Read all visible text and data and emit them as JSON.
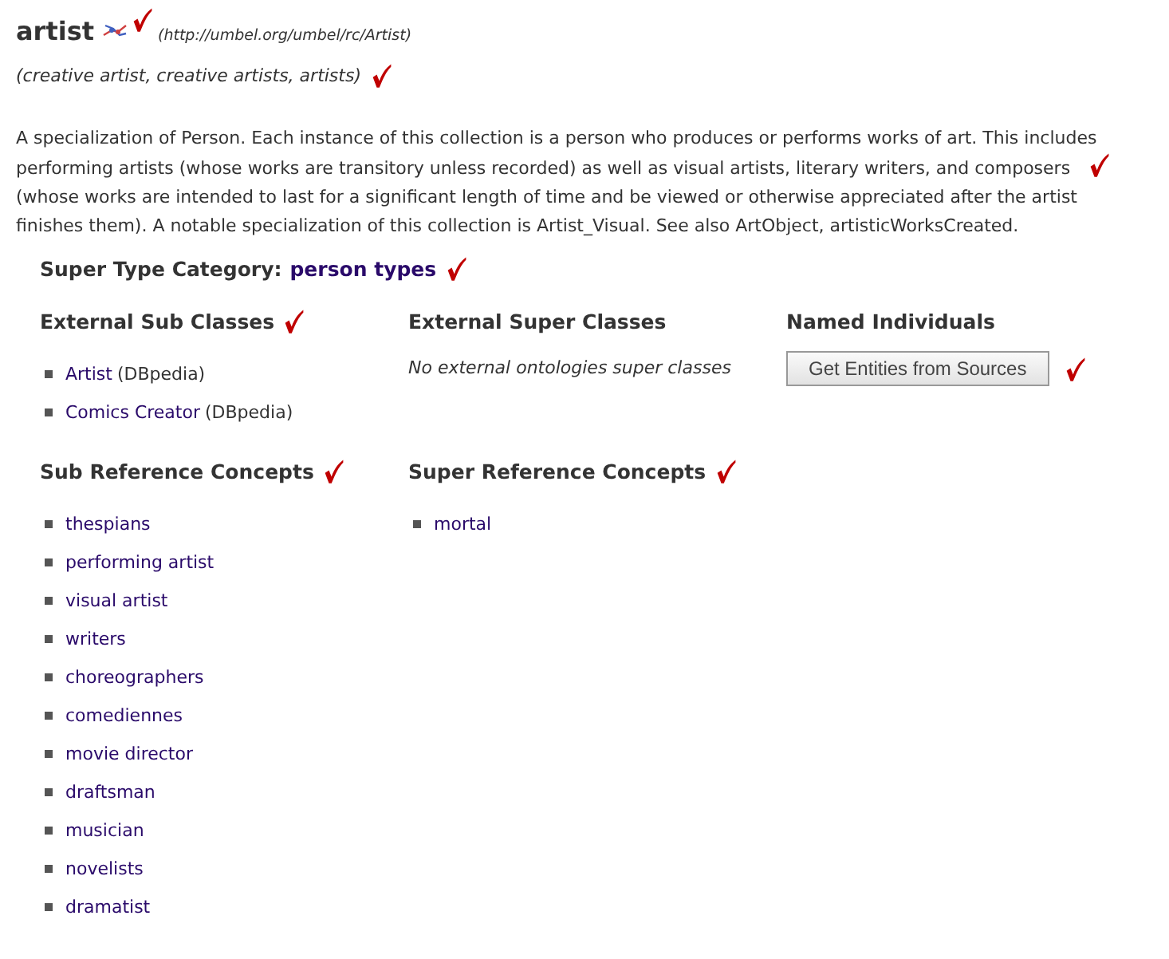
{
  "header": {
    "title": "artist",
    "uri": "(http://umbel.org/umbel/rc/Artist)",
    "marked": true
  },
  "alt_labels": {
    "text": "(creative artist, creative artists, artists)",
    "marked": true
  },
  "description": {
    "text": "A specialization of Person. Each instance of this collection is a person who produces or performs works of art. This includes performing artists (whose works are transitory unless recorded) as well as visual artists, literary writers, and composers",
    "text_continued": "(whose works are intended to last for a significant length of time and be viewed or otherwise appreciated after the artist finishes them). A notable specialization of this collection is Artist_Visual. See also ArtObject, artisticWorksCreated.",
    "marked": true
  },
  "super_type": {
    "label": "Super Type Category:",
    "value": "person types",
    "marked": true
  },
  "external_sub_classes": {
    "heading": "External Sub Classes",
    "marked": true,
    "items": [
      {
        "label": "Artist",
        "source": "(DBpedia)"
      },
      {
        "label": "Comics Creator",
        "source": "(DBpedia)"
      }
    ]
  },
  "external_super_classes": {
    "heading": "External Super Classes",
    "marked": false,
    "empty_text": "No external ontologies super classes"
  },
  "named_individuals": {
    "heading": "Named Individuals",
    "marked": false,
    "button": "Get Entities from Sources",
    "button_marked": true
  },
  "sub_reference_concepts": {
    "heading": "Sub Reference Concepts",
    "marked": true,
    "items": [
      "thespians",
      "performing artist",
      "visual artist",
      "writers",
      "choreographers",
      "comediennes",
      "movie director",
      "draftsman",
      "musician",
      "novelists",
      "dramatist"
    ]
  },
  "super_reference_concepts": {
    "heading": "Super Reference Concepts",
    "marked": true,
    "items": [
      "mortal"
    ]
  }
}
